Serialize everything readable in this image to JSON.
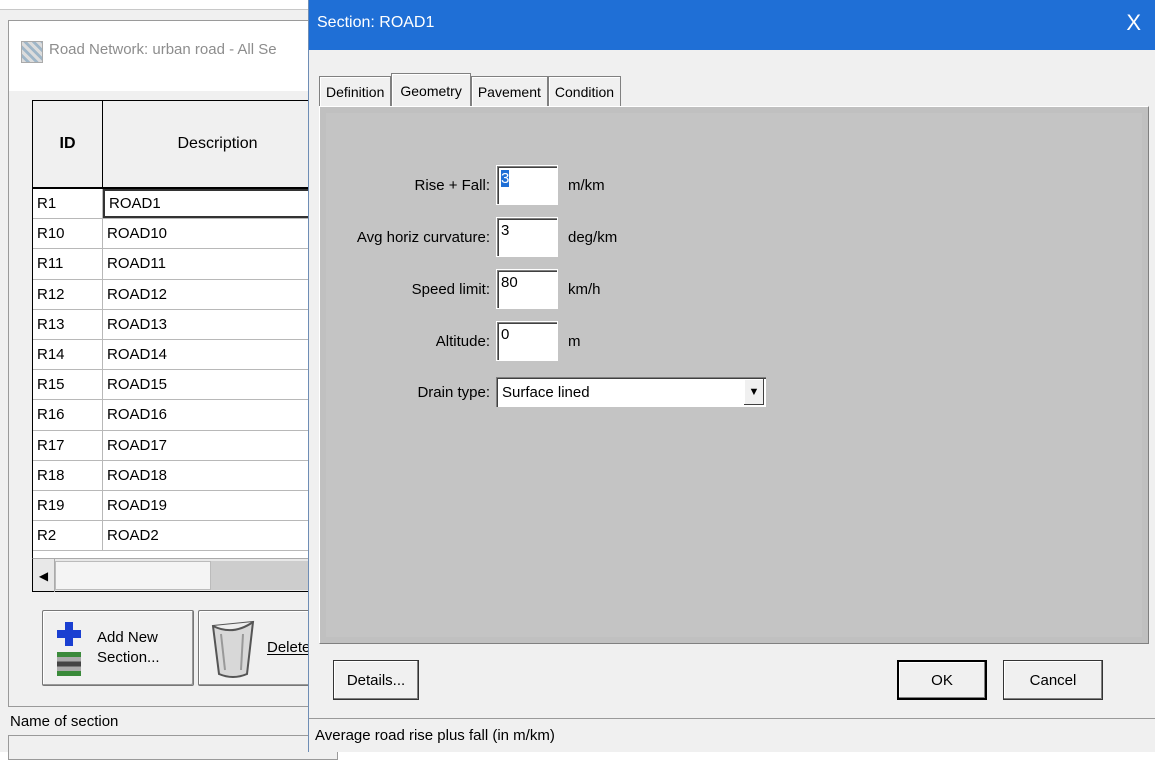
{
  "background_window": {
    "title": "Road Network: urban road - All Se",
    "table": {
      "headers": {
        "id": "ID",
        "description": "Description"
      },
      "rows": [
        {
          "id": "R1",
          "description": "ROAD1"
        },
        {
          "id": "R10",
          "description": "ROAD10"
        },
        {
          "id": "R11",
          "description": "ROAD11"
        },
        {
          "id": "R12",
          "description": "ROAD12"
        },
        {
          "id": "R13",
          "description": "ROAD13"
        },
        {
          "id": "R14",
          "description": "ROAD14"
        },
        {
          "id": "R15",
          "description": "ROAD15"
        },
        {
          "id": "R16",
          "description": "ROAD16"
        },
        {
          "id": "R17",
          "description": "ROAD17"
        },
        {
          "id": "R18",
          "description": "ROAD18"
        },
        {
          "id": "R19",
          "description": "ROAD19"
        },
        {
          "id": "R2",
          "description": "ROAD2"
        }
      ]
    },
    "buttons": {
      "add": "Add New\nSection...",
      "delete": "Delete"
    },
    "status": "Name of section"
  },
  "dialog": {
    "title": "Section: ROAD1",
    "close_label": "X",
    "tabs": [
      "Definition",
      "Geometry",
      "Pavement",
      "Condition"
    ],
    "active_tab": "Geometry",
    "fields": {
      "rise_fall": {
        "label": "Rise + Fall:",
        "value": "3",
        "unit": "m/km"
      },
      "curvature": {
        "label": "Avg horiz curvature:",
        "value": "3",
        "unit": "deg/km"
      },
      "speed_limit": {
        "label": "Speed limit:",
        "value": "80",
        "unit": "km/h"
      },
      "altitude": {
        "label": "Altitude:",
        "value": "0",
        "unit": "m"
      },
      "drain_type": {
        "label": "Drain type:",
        "value": "Surface lined"
      }
    },
    "buttons": {
      "details": "Details...",
      "ok": "OK",
      "cancel": "Cancel"
    },
    "status": "Average road rise plus fall (in m/km)"
  }
}
